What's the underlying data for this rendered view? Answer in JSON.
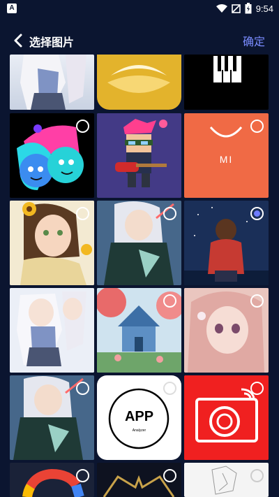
{
  "status_bar": {
    "time": "9:54",
    "app_icon_letter": "A"
  },
  "header": {
    "title": "选择图片",
    "confirm_label": "确定"
  },
  "grid": {
    "tiles": [
      {
        "id": "r0c0",
        "selected": false
      },
      {
        "id": "r0c1",
        "selected": false
      },
      {
        "id": "r0c2",
        "selected": false
      },
      {
        "id": "r1c0",
        "selected": false
      },
      {
        "id": "r1c1",
        "selected": false
      },
      {
        "id": "r1c2",
        "selected": false
      },
      {
        "id": "r2c0",
        "selected": false
      },
      {
        "id": "r2c1",
        "selected": false
      },
      {
        "id": "r2c2",
        "selected": true
      },
      {
        "id": "r3c0",
        "selected": false
      },
      {
        "id": "r3c1",
        "selected": false
      },
      {
        "id": "r3c2",
        "selected": false
      },
      {
        "id": "r4c0",
        "selected": false
      },
      {
        "id": "r4c1",
        "selected": false
      },
      {
        "id": "r4c2",
        "selected": false
      },
      {
        "id": "r5c0",
        "selected": false
      },
      {
        "id": "r5c1",
        "selected": false
      },
      {
        "id": "r5c2",
        "selected": false
      }
    ],
    "labels": {
      "app_text": "APP",
      "app_subtext": "Analyzer",
      "mi_text": "MI"
    }
  },
  "colors": {
    "background": "#0b1530",
    "accent": "#7a8cff",
    "selected_dot": "#6e7cff"
  }
}
